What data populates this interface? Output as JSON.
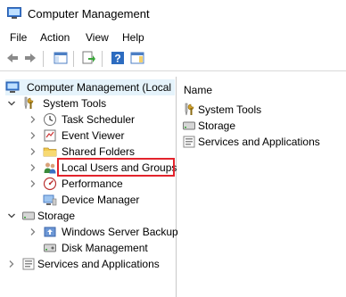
{
  "window": {
    "title": "Computer Management"
  },
  "menu": [
    "File",
    "Action",
    "View",
    "Help"
  ],
  "tree": {
    "root": "Computer Management (Local",
    "system_tools": "System Tools",
    "task_scheduler": "Task Scheduler",
    "event_viewer": "Event Viewer",
    "shared_folders": "Shared Folders",
    "local_users": "Local Users and Groups",
    "performance": "Performance",
    "device_manager": "Device Manager",
    "storage": "Storage",
    "windows_server_backup": "Windows Server Backup",
    "disk_management": "Disk Management",
    "services_apps": "Services and Applications"
  },
  "right": {
    "column_header": "Name",
    "items": [
      "System Tools",
      "Storage",
      "Services and Applications"
    ]
  },
  "colors": {
    "highlight": "#e3232c",
    "selection": "#e5f3fb"
  }
}
